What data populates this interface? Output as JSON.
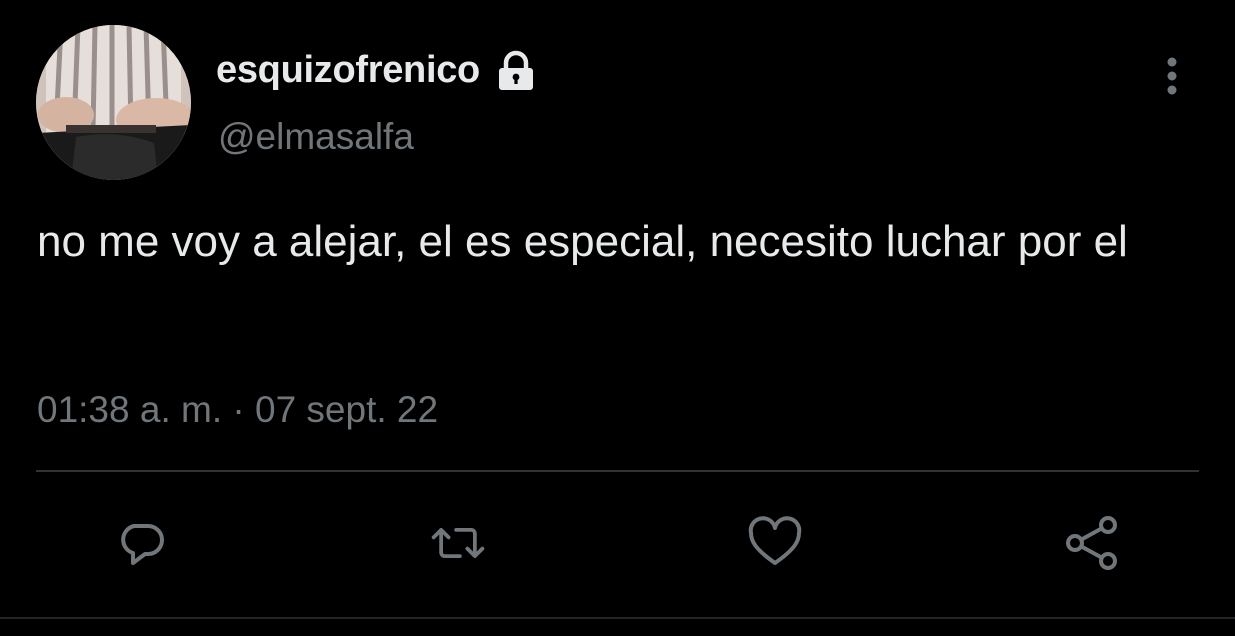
{
  "tweet": {
    "display_name": "esquizofrenico",
    "handle": "@elmasalfa",
    "text": "no me voy a alejar, el es especial, necesito luchar por el",
    "timestamp": "01:38 a. m. · 07 sept. 22"
  },
  "icons": {
    "lock": "lock-icon",
    "more": "more-vertical-icon",
    "reply": "reply-icon",
    "retweet": "retweet-icon",
    "like": "heart-icon",
    "share": "share-icon"
  },
  "colors": {
    "background": "#000000",
    "primary_text": "#e7e9ea",
    "secondary_text": "#71767b",
    "divider": "#2f3336"
  }
}
